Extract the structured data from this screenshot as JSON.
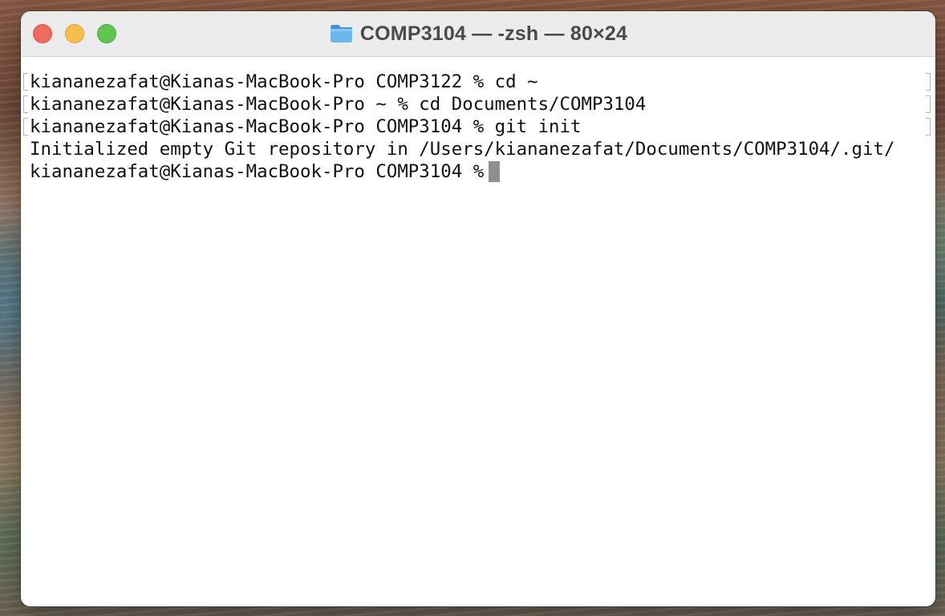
{
  "window": {
    "title": "COMP3104 — -zsh — 80×24",
    "folder_icon": "folder-icon"
  },
  "terminal": {
    "lines": [
      {
        "text": "kiananezafat@Kianas-MacBook-Pro COMP3122 % cd ~",
        "marked": true
      },
      {
        "text": "kiananezafat@Kianas-MacBook-Pro ~ % cd Documents/COMP3104",
        "marked": true
      },
      {
        "text": "kiananezafat@Kianas-MacBook-Pro COMP3104 % git init",
        "marked": true
      },
      {
        "text": "Initialized empty Git repository in /Users/kiananezafat/Documents/COMP3104/.git/",
        "marked": false
      }
    ],
    "prompt": "kiananezafat@Kianas-MacBook-Pro COMP3104 %"
  },
  "colors": {
    "close": "#ed6a5e",
    "minimize": "#f5bf4f",
    "zoom": "#61c554",
    "cursor": "#8f8f8f",
    "folder": "#5aa8e6"
  }
}
